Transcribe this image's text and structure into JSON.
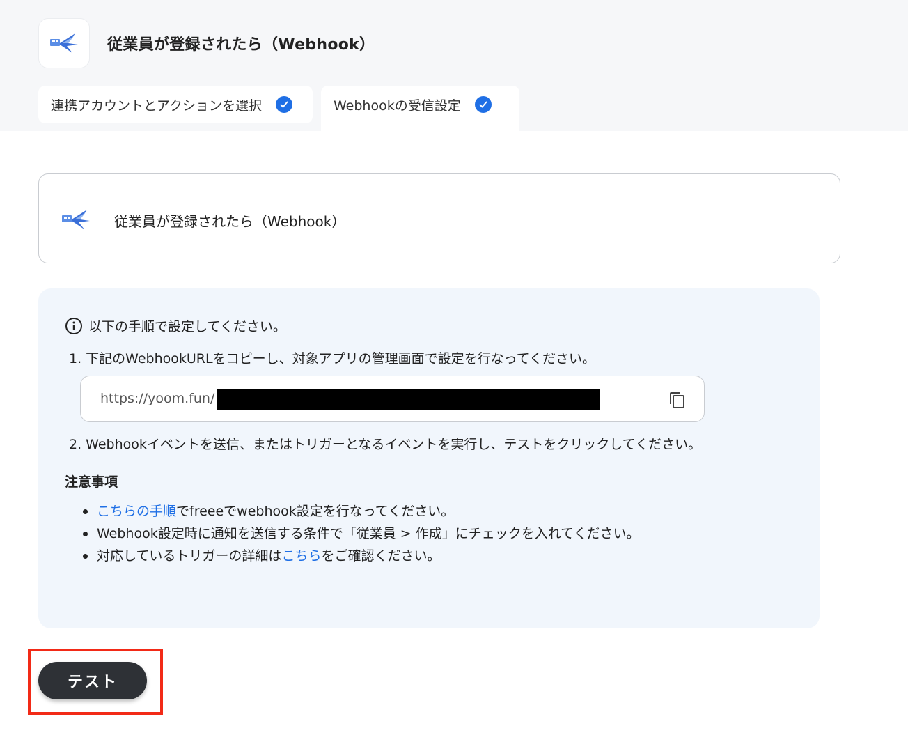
{
  "header": {
    "title": "従業員が登録されたら（Webhook）",
    "app_icon": "freee-bird-icon"
  },
  "tabs": [
    {
      "label": "連携アカウントとアクションを選択",
      "completed": true
    },
    {
      "label": "Webhookの受信設定",
      "completed": true,
      "active": true
    }
  ],
  "trigger_card": {
    "label": "従業員が登録されたら（Webhook）",
    "icon": "freee-bird-icon"
  },
  "instructions": {
    "heading": "以下の手順で設定してください。",
    "step1": "1. 下記のWebhookURLをコピーし、対象アプリの管理画面で設定を行なってください。",
    "url_prefix": "https://yoom.fun/",
    "step2": "2. Webhookイベントを送信、またはトリガーとなるイベントを実行し、テストをクリックしてください。"
  },
  "notes": {
    "title": "注意事項",
    "item1_link": "こちらの手順",
    "item1_rest": "でfreeeでwebhook設定を行なってください。",
    "item2": "Webhook設定時に通知を送信する条件で「従業員 > 作成」にチェックを入れてください。",
    "item3_before": "対応しているトリガーの詳細は",
    "item3_link": "こちら",
    "item3_after": "をご確認ください。"
  },
  "test_button": {
    "label": "テスト"
  },
  "colors": {
    "accent_blue": "#1f6fe5",
    "panel_bg": "#f1f6fc",
    "highlight_red": "#f22a17",
    "button_dark": "#2e3136"
  }
}
